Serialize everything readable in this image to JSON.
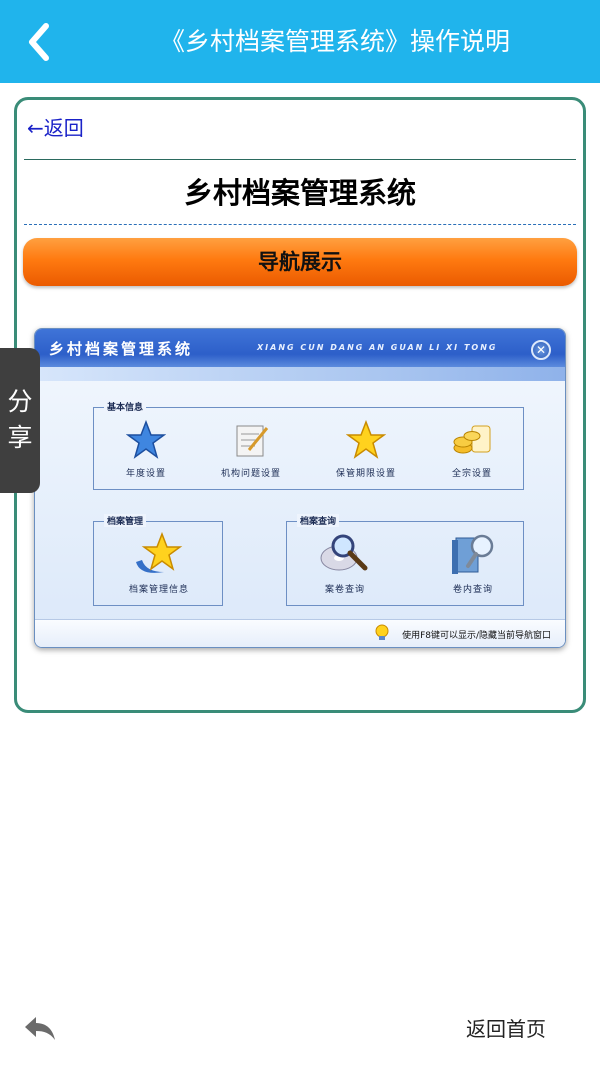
{
  "header": {
    "title": "《乡村档案管理系统》操作说明"
  },
  "content": {
    "back_label": "返回",
    "system_title": "乡村档案管理系统",
    "section_label": "导航展示"
  },
  "share_tab": {
    "line1": "分",
    "line2": "享"
  },
  "screenshot": {
    "title": "乡村档案管理系统",
    "pinyin": "XIANG CUN DANG AN GUAN LI XI TONG",
    "groups": {
      "basic": {
        "label": "基本信息",
        "items": [
          {
            "label": "年度设置",
            "icon": "blue-star-icon"
          },
          {
            "label": "机构问题设置",
            "icon": "notepad-pencil-icon"
          },
          {
            "label": "保管期限设置",
            "icon": "gold-star-icon"
          },
          {
            "label": "全宗设置",
            "icon": "coins-icon"
          }
        ]
      },
      "archive": {
        "label": "档案管理",
        "items": [
          {
            "label": "档案管理信息",
            "icon": "star-swoosh-icon"
          }
        ]
      },
      "query": {
        "label": "档案查询",
        "items": [
          {
            "label": "案卷查询",
            "icon": "magnifier-cd-icon"
          },
          {
            "label": "卷内查询",
            "icon": "book-magnifier-icon"
          }
        ]
      }
    },
    "tip": "使用F8键可以显示/隐藏当前导航窗口"
  },
  "footer": {
    "home_label": "返回首页"
  },
  "colors": {
    "header_bg": "#20b4ec",
    "card_border": "#3a8c78",
    "nav_orange": "#ff7a10"
  }
}
